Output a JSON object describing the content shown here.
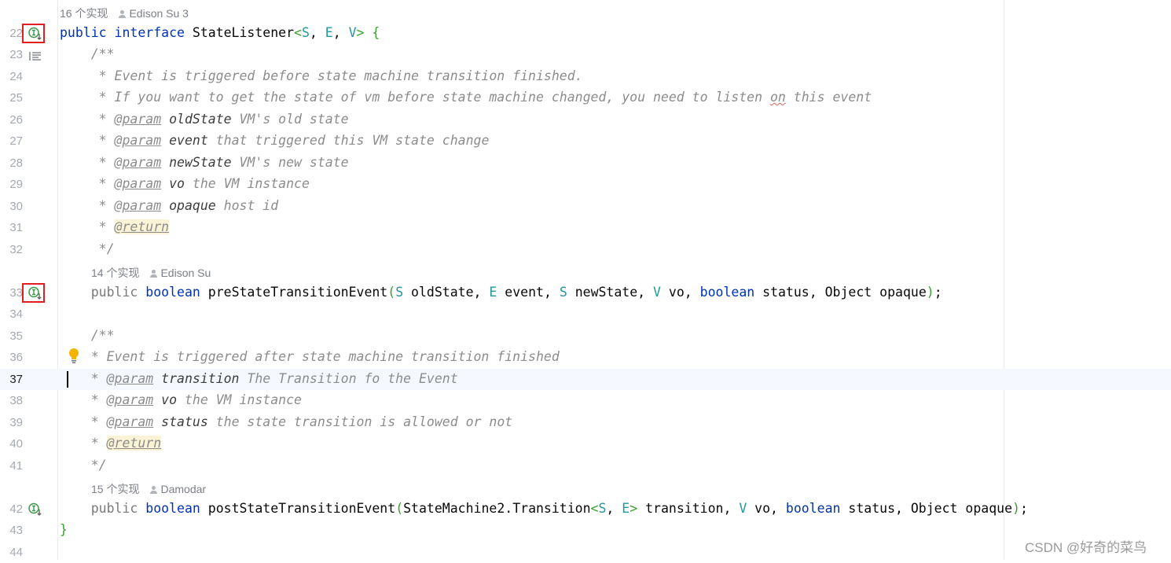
{
  "editor": {
    "rows": [
      {
        "type": "hint",
        "indent": 0,
        "count": "16 个实现",
        "author": "Edison Su 3"
      },
      {
        "type": "code",
        "line": "22",
        "gutter": "implemented",
        "boxed": true,
        "tokens": [
          [
            "public ",
            "kw"
          ],
          [
            "interface ",
            "kw"
          ],
          [
            "StateListener",
            ""
          ],
          [
            "<",
            "br"
          ],
          [
            "S",
            "tp"
          ],
          [
            ", ",
            ""
          ],
          [
            "E",
            "tp"
          ],
          [
            ", ",
            ""
          ],
          [
            "V",
            "tp"
          ],
          [
            "> ",
            "br"
          ],
          [
            "{",
            "br"
          ]
        ]
      },
      {
        "type": "code",
        "line": "23",
        "gutter": "doc",
        "tokens": [
          [
            "    /**",
            "cm"
          ]
        ]
      },
      {
        "type": "code",
        "line": "24",
        "tokens": [
          [
            "     * Event is triggered before state machine transition finished.",
            "cm"
          ]
        ]
      },
      {
        "type": "code",
        "line": "25",
        "tokens": [
          [
            "     * If you want to get the state of vm before state machine changed, you need to listen ",
            "cm"
          ],
          [
            "on",
            "sp"
          ],
          [
            " this event",
            "cm"
          ]
        ]
      },
      {
        "type": "code",
        "line": "26",
        "tokens": [
          [
            "     * ",
            "cm"
          ],
          [
            "@param",
            "tag"
          ],
          [
            " ",
            "cm"
          ],
          [
            "oldState",
            "pn"
          ],
          [
            " VM's old state",
            "cm"
          ]
        ]
      },
      {
        "type": "code",
        "line": "27",
        "tokens": [
          [
            "     * ",
            "cm"
          ],
          [
            "@param",
            "tag"
          ],
          [
            " ",
            "cm"
          ],
          [
            "event",
            "pn"
          ],
          [
            " that triggered this VM state change",
            "cm"
          ]
        ]
      },
      {
        "type": "code",
        "line": "28",
        "tokens": [
          [
            "     * ",
            "cm"
          ],
          [
            "@param",
            "tag"
          ],
          [
            " ",
            "cm"
          ],
          [
            "newState",
            "pn"
          ],
          [
            " VM's new state",
            "cm"
          ]
        ]
      },
      {
        "type": "code",
        "line": "29",
        "tokens": [
          [
            "     * ",
            "cm"
          ],
          [
            "@param",
            "tag"
          ],
          [
            " ",
            "cm"
          ],
          [
            "vo",
            "pn"
          ],
          [
            " the VM instance",
            "cm"
          ]
        ]
      },
      {
        "type": "code",
        "line": "30",
        "tokens": [
          [
            "     * ",
            "cm"
          ],
          [
            "@param",
            "tag"
          ],
          [
            " ",
            "cm"
          ],
          [
            "opaque",
            "pn"
          ],
          [
            " host id",
            "cm"
          ]
        ]
      },
      {
        "type": "code",
        "line": "31",
        "tokens": [
          [
            "     * ",
            "cm"
          ],
          [
            "@return",
            "tagr"
          ]
        ]
      },
      {
        "type": "code",
        "line": "32",
        "tokens": [
          [
            "     */",
            "cm"
          ]
        ]
      },
      {
        "type": "hint",
        "indent": 4,
        "count": "14 个实现",
        "author": "Edison Su"
      },
      {
        "type": "code",
        "line": "33",
        "gutter": "implemented",
        "boxed": true,
        "tokens": [
          [
            "    public ",
            "mod"
          ],
          [
            "boolean ",
            "kw"
          ],
          [
            "preStateTransitionEvent",
            ""
          ],
          [
            "(",
            "br"
          ],
          [
            "S",
            "tp"
          ],
          [
            " oldState, ",
            ""
          ],
          [
            "E",
            "tp"
          ],
          [
            " event, ",
            ""
          ],
          [
            "S",
            "tp"
          ],
          [
            " newState, ",
            ""
          ],
          [
            "V",
            "tp"
          ],
          [
            " vo, ",
            ""
          ],
          [
            "boolean ",
            "kw"
          ],
          [
            "status, Object opaque",
            ""
          ],
          [
            ")",
            "br"
          ],
          [
            ";",
            ""
          ]
        ]
      },
      {
        "type": "code",
        "line": "34",
        "tokens": []
      },
      {
        "type": "code",
        "line": "35",
        "tokens": [
          [
            "    /**",
            "cm"
          ]
        ]
      },
      {
        "type": "code",
        "line": "36",
        "bulb": true,
        "tokens": [
          [
            "    * Event is triggered after state machine transition finished",
            "cm"
          ]
        ]
      },
      {
        "type": "code",
        "line": "37",
        "current": true,
        "tokens": [
          [
            "    * ",
            "cm"
          ],
          [
            "@param",
            "tag"
          ],
          [
            " ",
            "cm"
          ],
          [
            "transition",
            "pn"
          ],
          [
            " The Transition fo the Event",
            "cm"
          ]
        ]
      },
      {
        "type": "code",
        "line": "38",
        "tokens": [
          [
            "    * ",
            "cm"
          ],
          [
            "@param",
            "tag"
          ],
          [
            " ",
            "cm"
          ],
          [
            "vo",
            "pn"
          ],
          [
            " the VM instance",
            "cm"
          ]
        ]
      },
      {
        "type": "code",
        "line": "39",
        "tokens": [
          [
            "    * ",
            "cm"
          ],
          [
            "@param",
            "tag"
          ],
          [
            " ",
            "cm"
          ],
          [
            "status",
            "pn"
          ],
          [
            " the state transition is allowed or not",
            "cm"
          ]
        ]
      },
      {
        "type": "code",
        "line": "40",
        "tokens": [
          [
            "    * ",
            "cm"
          ],
          [
            "@return",
            "tagr"
          ]
        ]
      },
      {
        "type": "code",
        "line": "41",
        "tokens": [
          [
            "    */",
            "cm"
          ]
        ]
      },
      {
        "type": "hint",
        "indent": 4,
        "count": "15 个实现",
        "author": "Damodar"
      },
      {
        "type": "code",
        "line": "42",
        "gutter": "implemented",
        "tokens": [
          [
            "    public ",
            "mod"
          ],
          [
            "boolean ",
            "kw"
          ],
          [
            "postStateTransitionEvent",
            ""
          ],
          [
            "(",
            "br"
          ],
          [
            "StateMachine2.Transition",
            ""
          ],
          [
            "<",
            "br"
          ],
          [
            "S",
            "tp"
          ],
          [
            ", ",
            ""
          ],
          [
            "E",
            "tp"
          ],
          [
            ">",
            "br"
          ],
          [
            " transition, ",
            ""
          ],
          [
            "V",
            "tp"
          ],
          [
            " vo, ",
            ""
          ],
          [
            "boolean ",
            "kw"
          ],
          [
            "status, Object opaque",
            ""
          ],
          [
            ")",
            "br"
          ],
          [
            ";",
            ""
          ]
        ]
      },
      {
        "type": "code",
        "line": "43",
        "tokens": [
          [
            "}",
            "br"
          ]
        ]
      },
      {
        "type": "code",
        "line": "44",
        "tokens": []
      }
    ]
  },
  "colors": {
    "keyword": "#0033b3",
    "type_param": "#20999d",
    "bracket": "#38a02c",
    "comment": "#8c8c8c",
    "current_line": "#f5f8fe",
    "highlight_box": "#e02020"
  },
  "watermark": "CSDN @好奇的菜鸟"
}
